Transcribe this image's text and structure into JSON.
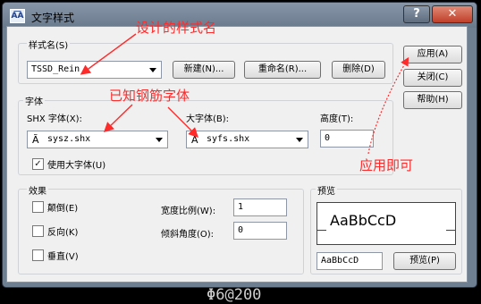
{
  "window": {
    "title": "文字样式",
    "icon_text": "A͞A",
    "help_glyph": "?",
    "close_glyph": "✕"
  },
  "style_name": {
    "group_label": "样式名(S)",
    "selected": "TSSD_Rein",
    "new_button": "新建(N)...",
    "rename_button": "重命名(R)...",
    "delete_button": "删除(D)"
  },
  "font": {
    "group_label": "字体",
    "shx_label": "SHX 字体(X):",
    "shx_value": "sysz.shx",
    "bigfont_label": "大字体(B):",
    "bigfont_value": "syfs.shx",
    "height_label": "高度(T):",
    "height_value": "0",
    "use_bigfont_label": "使用大字体(U)",
    "use_bigfont_checked": true
  },
  "effects": {
    "group_label": "效果",
    "upside_down": "颠倒(E)",
    "backwards": "反向(K)",
    "vertical": "垂直(V)",
    "width_label": "宽度比例(W):",
    "width_value": "1",
    "oblique_label": "倾斜角度(O):",
    "oblique_value": "0"
  },
  "preview": {
    "group_label": "预览",
    "sample": "AaBbCcD",
    "input_value": "AaBbCcD",
    "button": "预览(P)"
  },
  "side_buttons": {
    "apply": "应用(A)",
    "close": "关闭(C)",
    "help": "帮助(H)"
  },
  "annotations": {
    "style_name_note": "设计的样式名",
    "font_note": "已知钢筋字体",
    "apply_note": "应用即可"
  },
  "background_text": "Φ6@200",
  "colors": {
    "annotation": "#ff2a2a",
    "title_bar": "#6f7f92",
    "close_button": "#c0402a"
  }
}
